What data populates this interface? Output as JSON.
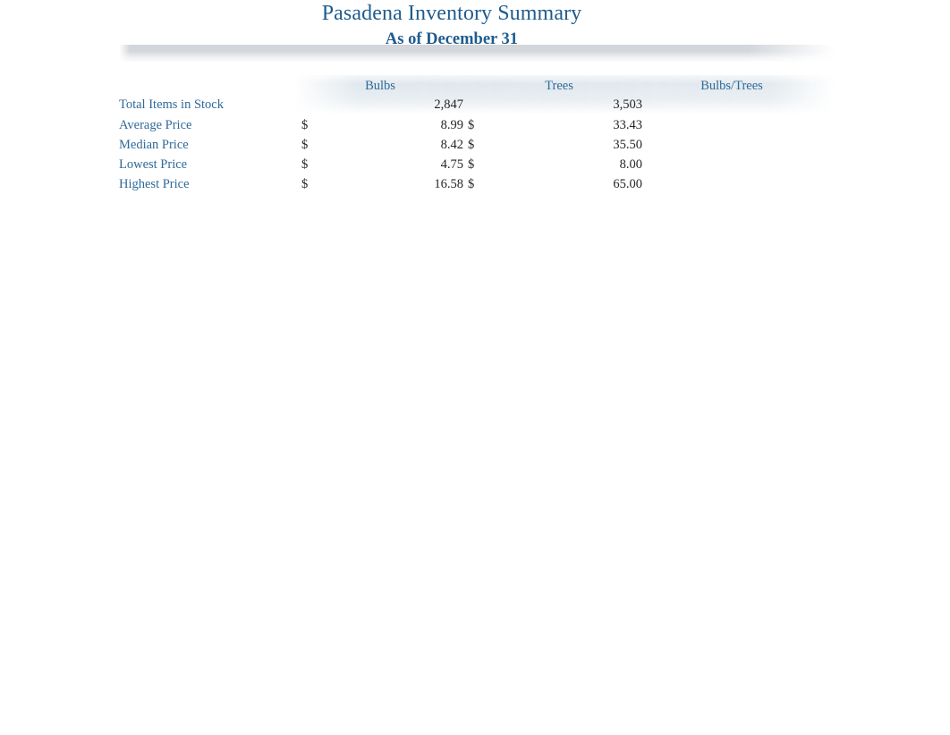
{
  "document": {
    "title": "Pasadena Inventory Summary",
    "subtitle": "As of December 31"
  },
  "table": {
    "row_header_label": "",
    "columns": [
      {
        "key": "bulbs",
        "label": "Bulbs"
      },
      {
        "key": "trees",
        "label": "Trees"
      },
      {
        "key": "bulbs_trees",
        "label": "Bulbs/Trees"
      }
    ],
    "rows": [
      {
        "label": "Total Items in Stock",
        "bulbs_currency": "",
        "bulbs_value": "2,847",
        "trees_currency": "",
        "trees_value": "3,503",
        "ratio_currency": "",
        "ratio_value": ""
      },
      {
        "label": "Average Price",
        "bulbs_currency": "$",
        "bulbs_value": "8.99",
        "trees_currency": "$",
        "trees_value": "33.43",
        "ratio_currency": "",
        "ratio_value": ""
      },
      {
        "label": "Median Price",
        "bulbs_currency": "$",
        "bulbs_value": "8.42",
        "trees_currency": "$",
        "trees_value": "35.50",
        "ratio_currency": "",
        "ratio_value": ""
      },
      {
        "label": "Lowest Price",
        "bulbs_currency": "$",
        "bulbs_value": "4.75",
        "trees_currency": "$",
        "trees_value": "8.00",
        "ratio_currency": "",
        "ratio_value": ""
      },
      {
        "label": "Highest Price",
        "bulbs_currency": "$",
        "bulbs_value": "16.58",
        "trees_currency": "$",
        "trees_value": "65.00",
        "ratio_currency": "",
        "ratio_value": ""
      }
    ]
  },
  "theme": {
    "heading_color": "#1f5c8e",
    "label_color": "#2f6a9a",
    "value_color": "#262626",
    "band_color": "#dde5eb",
    "divider_color": "#d2d6da",
    "page_background": "#ffffff"
  }
}
